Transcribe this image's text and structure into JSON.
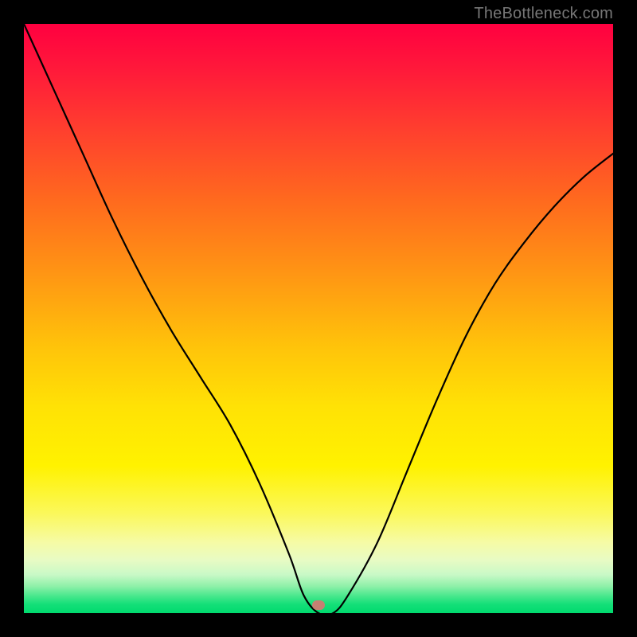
{
  "watermark": {
    "text": "TheBottleneck.com"
  },
  "marker": {
    "color": "#c58072",
    "x_fraction": 0.5
  },
  "chart_data": {
    "type": "line",
    "title": "",
    "xlabel": "",
    "ylabel": "",
    "xlim": [
      0,
      1
    ],
    "ylim": [
      0,
      1
    ],
    "series": [
      {
        "name": "curve",
        "x": [
          0.0,
          0.05,
          0.1,
          0.15,
          0.2,
          0.25,
          0.3,
          0.35,
          0.4,
          0.45,
          0.475,
          0.5,
          0.525,
          0.55,
          0.6,
          0.65,
          0.7,
          0.75,
          0.8,
          0.85,
          0.9,
          0.95,
          1.0
        ],
        "values": [
          1.0,
          0.89,
          0.78,
          0.67,
          0.57,
          0.48,
          0.4,
          0.32,
          0.22,
          0.1,
          0.03,
          0.0,
          0.0,
          0.03,
          0.12,
          0.24,
          0.36,
          0.47,
          0.56,
          0.63,
          0.69,
          0.74,
          0.78
        ]
      }
    ],
    "annotations": [
      {
        "name": "minimum-marker",
        "x": 0.5,
        "y": 0.0
      }
    ]
  }
}
